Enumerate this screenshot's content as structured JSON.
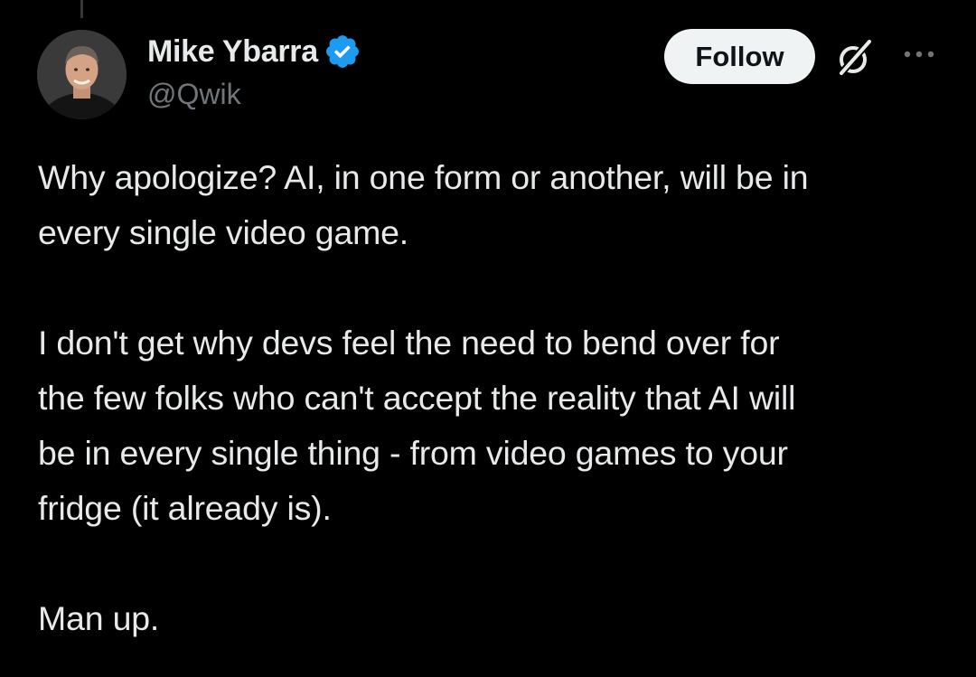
{
  "author": {
    "display_name": "Mike Ybarra",
    "handle": "@Qwik",
    "verified": true,
    "verified_color": "#1d9bf0"
  },
  "actions": {
    "follow_label": "Follow",
    "grok_icon": "grok-icon",
    "more_icon": "more-horizontal-icon"
  },
  "tweet": {
    "paragraphs": [
      [
        "Why apologize? AI, in one form or another, will be in",
        "every single video game."
      ],
      [
        "I don't get why devs feel the need to bend over for",
        "the few folks who can't accept the reality that AI will",
        "be in every single thing - from video games to your",
        "fridge (it already is)."
      ],
      [
        "Man up."
      ]
    ]
  },
  "colors": {
    "background": "#000000",
    "text_primary": "#e7e9ea",
    "text_secondary": "#71767b",
    "follow_bg": "#eff3f4",
    "follow_text": "#0f1419"
  }
}
